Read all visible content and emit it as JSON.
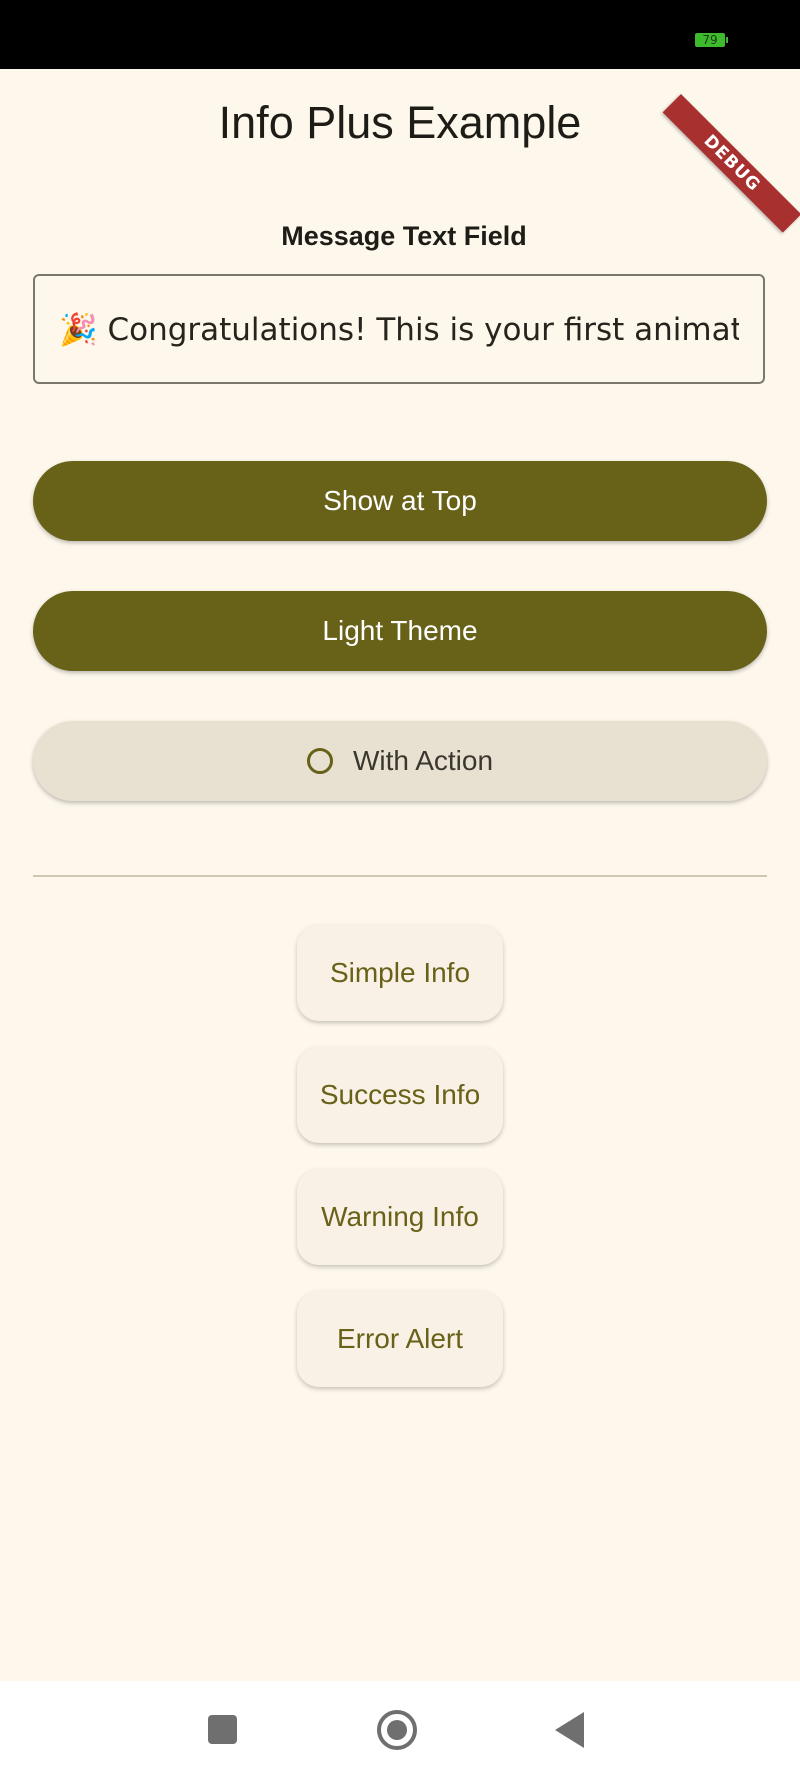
{
  "status_bar": {
    "battery_level": "79"
  },
  "debug_banner": {
    "label": "DEBUG"
  },
  "app": {
    "title": "Info Plus Example",
    "message_field": {
      "label": "Message Text Field",
      "value": "🎉 Congratulations! This is your first animated info"
    },
    "buttons": {
      "show_at_top": "Show at Top",
      "light_theme": "Light Theme",
      "with_action": "With Action"
    },
    "info_buttons": {
      "simple": "Simple Info",
      "success": "Success Info",
      "warning": "Warning Info",
      "error": "Error Alert"
    }
  },
  "colors": {
    "background": "#fdf7ec",
    "primary": "#686118",
    "tonal_button": "#e8e1d2",
    "debug_ribbon": "#a8302f"
  },
  "icons": {
    "with_action_toggle": "radio-unchecked-icon",
    "nav_recents": "square-icon",
    "nav_home": "circle-icon",
    "nav_back": "triangle-back-icon"
  }
}
